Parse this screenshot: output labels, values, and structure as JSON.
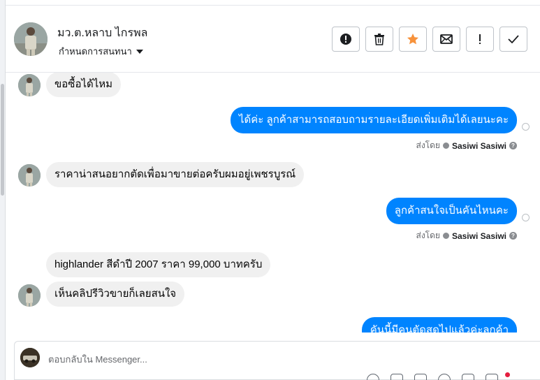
{
  "header": {
    "contact_name": "มว.ต.หลาบ ไกรพล",
    "assign_label": "กำหนดการสนทนา",
    "actions": [
      {
        "name": "spam-button",
        "icon": "alert-circle-icon"
      },
      {
        "name": "delete-button",
        "icon": "trash-icon"
      },
      {
        "name": "star-button",
        "icon": "star-icon"
      },
      {
        "name": "mark-unread-button",
        "icon": "envelope-icon"
      },
      {
        "name": "follow-up-button",
        "icon": "exclamation-icon"
      },
      {
        "name": "mark-done-button",
        "icon": "check-icon"
      }
    ]
  },
  "messages": [
    {
      "direction": "in",
      "text": "ขอซื้อได้ไหม",
      "avatar": true
    },
    {
      "direction": "out",
      "text": "ได้ค่ะ ลูกค้าสามารถสอบถามรายละเอียดเพิ่มเติมได้เลยนะคะ"
    },
    {
      "direction": "in",
      "text": "ราคาน่าสนอยากตัดเพื่อมาขายต่อครับผมอยู่เพชรบูรณ์",
      "avatar": true
    },
    {
      "direction": "out",
      "text": "ลูกค้าสนใจเป็นคันไหนคะ"
    },
    {
      "direction": "in",
      "text": "highlander สีดำปี 2007 ราคา 99,000 บาทครับ",
      "avatar": false
    },
    {
      "direction": "in",
      "text": "เห็นคลิปรีวิวขายก็เลยสนใจ",
      "avatar": true
    },
    {
      "direction": "out",
      "text": "คันนี้มีคนตัดสดไปแล้วค่ะลูกค้า"
    }
  ],
  "sent_by": {
    "prefix": "ส่งโดย",
    "agent": "Sasiwi Sasiwi"
  },
  "composer": {
    "placeholder": "ตอบกลับใน Messenger..."
  },
  "colors": {
    "accent": "#0084ff",
    "star": "#f7923b",
    "incoming_bubble": "#f0f0f0"
  }
}
